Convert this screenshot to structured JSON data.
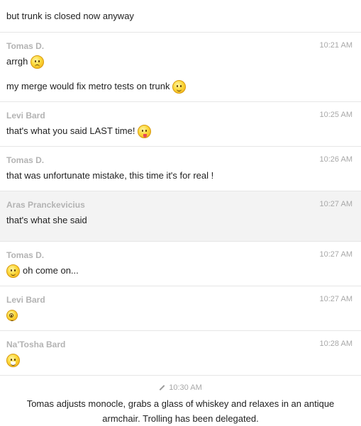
{
  "top_message": {
    "text": "but trunk is closed now anyway"
  },
  "messages": [
    {
      "author": "Tomas D.",
      "time": "10:21 AM",
      "lines": [
        {
          "text": "arrgh",
          "emoji": "sad-face-icon"
        },
        {
          "text": "my merge would fix metro tests on trunk",
          "emoji": "smile-face-icon"
        }
      ]
    },
    {
      "author": "Levi Bard",
      "time": "10:25 AM",
      "lines": [
        {
          "text": "that's what you said LAST time!",
          "emoji": "tongue-face-icon"
        }
      ]
    },
    {
      "author": "Tomas D.",
      "time": "10:26 AM",
      "lines": [
        {
          "text": "that was unfortunate mistake, this time it's for real !"
        }
      ]
    },
    {
      "author": "Aras Pranckevicius",
      "time": "10:27 AM",
      "highlighted": true,
      "lines": [
        {
          "text": "that's what she said"
        }
      ]
    },
    {
      "author": "Tomas D.",
      "time": "10:27 AM",
      "lines": [
        {
          "text": "oh come on...",
          "emoji_before": "smile-face-icon"
        }
      ]
    },
    {
      "author": "Levi Bard",
      "time": "10:27 AM",
      "lines": [
        {
          "emoji": "monocle-face-icon"
        }
      ]
    },
    {
      "author": "Na'Tosha Bard",
      "time": "10:28 AM",
      "lines": [
        {
          "emoji": "laughing-face-icon"
        }
      ]
    }
  ],
  "system_message": {
    "time": "10:30 AM",
    "text": "Tomas adjusts monocle, grabs a glass of whiskey and relaxes in an antique armchair. Trolling has been delegated."
  }
}
